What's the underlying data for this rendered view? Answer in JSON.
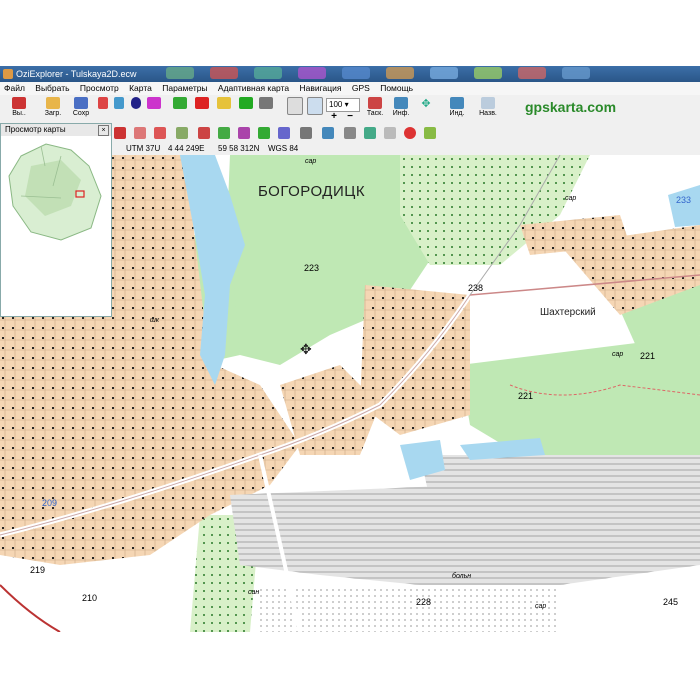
{
  "window": {
    "title": "OziExplorer - Tulskaya2D.ecw"
  },
  "menu": [
    "Файл",
    "Выбрать",
    "Просмотр",
    "Карта",
    "Параметры",
    "Адаптивная карта",
    "Навигация",
    "GPS",
    "Помощь"
  ],
  "toolbar": {
    "buttons": [
      "Вы..",
      "Загр.",
      "Сохр",
      "Таск.",
      "Инф.",
      "Инд.",
      "Назв."
    ],
    "zoom": "100",
    "brand": "gpskarta.com"
  },
  "overview": {
    "title": "Просмотр карты"
  },
  "status": {
    "zone": "UTM 37U",
    "easting": "4 44 249E",
    "northing": "59 58 312N",
    "datum": "WGS 84"
  },
  "map": {
    "town": "БОГОРОДИЦК",
    "settlement": "Шахтерский",
    "numbers": [
      "223",
      "238",
      "221",
      "221",
      "219",
      "210",
      "228",
      "245",
      "209",
      "233"
    ],
    "small_labels": [
      "сар",
      "сар",
      "сар",
      "сар",
      "больн",
      "сан",
      "шк"
    ]
  }
}
